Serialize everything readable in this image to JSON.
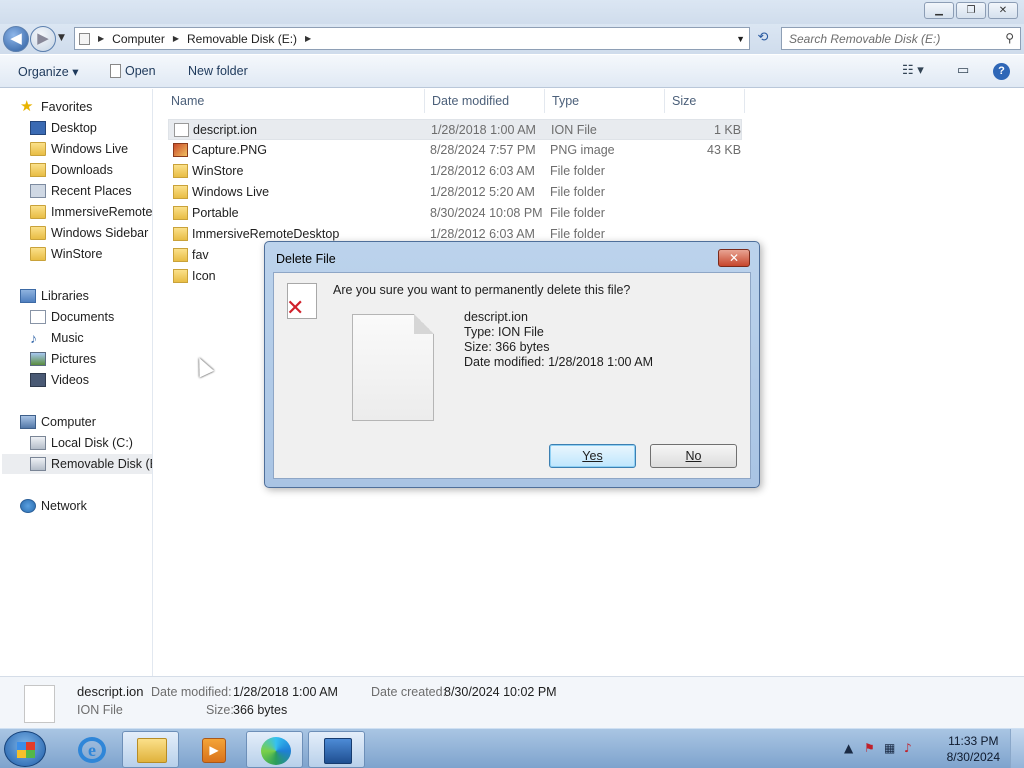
{
  "window": {
    "controls": [
      "▁",
      "❐",
      "✕"
    ]
  },
  "address": {
    "segments": [
      "Computer",
      "Removable Disk (E:)"
    ],
    "search_placeholder": "Search Removable Disk (E:)"
  },
  "toolbar": {
    "organize": "Organize ▾",
    "open": "Open",
    "new_folder": "New folder"
  },
  "sidebar": {
    "favorites": "Favorites",
    "favorite_items": [
      "Desktop",
      "Windows Live",
      "Downloads",
      "Recent Places",
      "ImmersiveRemoteD",
      "Windows Sidebar",
      "WinStore"
    ],
    "libraries": "Libraries",
    "library_items": [
      "Documents",
      "Music",
      "Pictures",
      "Videos"
    ],
    "computer": "Computer",
    "computer_items": [
      "Local Disk (C:)",
      "Removable Disk (E:"
    ],
    "network": "Network"
  },
  "filelist": {
    "columns": [
      "Name",
      "Date modified",
      "Type",
      "Size"
    ],
    "rows": [
      {
        "name": "descript.ion",
        "date": "1/28/2018 1:00 AM",
        "type": "ION File",
        "size": "1 KB",
        "icon": "file-icon"
      },
      {
        "name": "Capture.PNG",
        "date": "8/28/2024 7:57 PM",
        "type": "PNG image",
        "size": "43 KB",
        "icon": "png-icon"
      },
      {
        "name": "WinStore",
        "date": "1/28/2012 6:03 AM",
        "type": "File folder",
        "size": "",
        "icon": "folder-icon"
      },
      {
        "name": "Windows Live",
        "date": "1/28/2012 5:20 AM",
        "type": "File folder",
        "size": "",
        "icon": "folder-icon"
      },
      {
        "name": "Portable",
        "date": "8/30/2024 10:08 PM",
        "type": "File folder",
        "size": "",
        "icon": "folder-icon"
      },
      {
        "name": "ImmersiveRemoteDesktop",
        "date": "1/28/2012 6:03 AM",
        "type": "File folder",
        "size": "",
        "icon": "folder-icon"
      },
      {
        "name": "fav",
        "date": "",
        "type": "",
        "size": "",
        "icon": "folder-icon"
      },
      {
        "name": "Icon",
        "date": "",
        "type": "",
        "size": "",
        "icon": "folder-icon"
      }
    ]
  },
  "details": {
    "name": "descript.ion",
    "type": "ION File",
    "modified_label": "Date modified:",
    "modified": "1/28/2018 1:00 AM",
    "created_label": "Date created:",
    "created": "8/30/2024 10:02 PM",
    "size_label": "Size:",
    "size": "366 bytes"
  },
  "dialog": {
    "title": "Delete File",
    "question": "Are you sure you want to permanently delete this file?",
    "file_name": "descript.ion",
    "file_type": "Type: ION File",
    "file_size": "Size: 366 bytes",
    "file_modified": "Date modified: 1/28/2018 1:00 AM",
    "yes": "Yes",
    "no": "No"
  },
  "taskbar": {
    "time": "11:33 PM",
    "date": "8/30/2024"
  }
}
